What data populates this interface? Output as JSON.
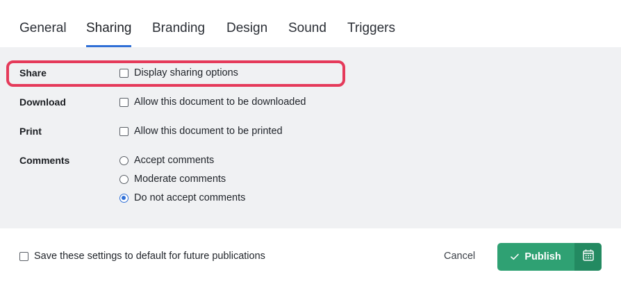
{
  "tabs": [
    {
      "label": "General",
      "active": false
    },
    {
      "label": "Sharing",
      "active": true
    },
    {
      "label": "Branding",
      "active": false
    },
    {
      "label": "Design",
      "active": false
    },
    {
      "label": "Sound",
      "active": false
    },
    {
      "label": "Triggers",
      "active": false
    }
  ],
  "settings": {
    "share": {
      "label": "Share",
      "option": "Display sharing options",
      "checked": false
    },
    "download": {
      "label": "Download",
      "option": "Allow this document to be downloaded",
      "checked": false
    },
    "print": {
      "label": "Print",
      "option": "Allow this document to be printed",
      "checked": false
    },
    "comments": {
      "label": "Comments",
      "options": [
        "Accept comments",
        "Moderate comments",
        "Do not accept comments"
      ],
      "selected": "Do not accept comments"
    }
  },
  "footer": {
    "default_label": "Save these settings to default for future publications",
    "default_checked": false,
    "cancel_label": "Cancel",
    "publish_label": "Publish"
  },
  "icons": {
    "publish": "check-icon",
    "schedule": "calendar-icon"
  },
  "colors": {
    "accent": "#2f6fd6",
    "highlight": "#e53a5a",
    "publish": "#2fa173",
    "publish_dark": "#238a61"
  }
}
